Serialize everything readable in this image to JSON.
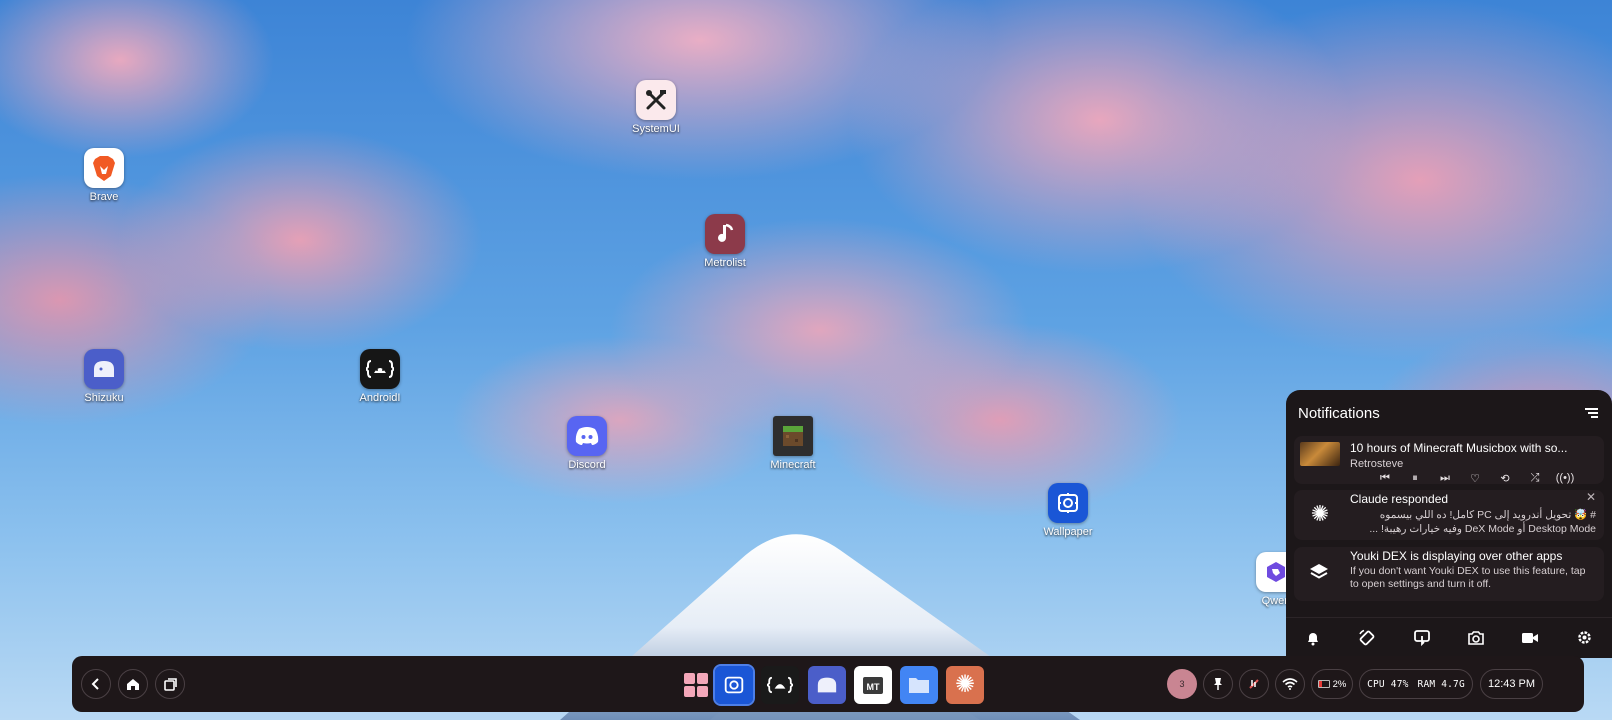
{
  "desktop": {
    "icons": [
      {
        "label": "Brave",
        "icon": "brave-lion-icon"
      },
      {
        "label": "SystemUI",
        "icon": "tools-icon"
      },
      {
        "label": "Metrolist",
        "icon": "music-note-icon"
      },
      {
        "label": "Shizuku",
        "icon": "shizuku-icon"
      },
      {
        "label": "AndroidI",
        "icon": "android-dev-icon"
      },
      {
        "label": "Discord",
        "icon": "discord-icon"
      },
      {
        "label": "Minecraft",
        "icon": "minecraft-block-icon"
      },
      {
        "label": "Wallpaper",
        "icon": "wallpaper-gear-icon"
      },
      {
        "label": "Qwen",
        "icon": "qwen-icon"
      }
    ]
  },
  "notifications": {
    "title": "Notifications",
    "items": [
      {
        "type": "media",
        "title": "10 hours of Minecraft Musicbox with so...",
        "subtitle": "Retrosteve",
        "controls": [
          "previous",
          "pause",
          "next",
          "favorite",
          "repeat",
          "shuffle",
          "cast"
        ]
      },
      {
        "type": "message",
        "title": "Claude responded",
        "line1": "# 🤯 تحويل أندرويد إلى PC كامل! ده اللي بيسموه",
        "line2": "Desktop Mode أو DeX Mode وفيه خيارات رهيبة! ..."
      },
      {
        "type": "system",
        "title": "Youki DEX is displaying over other apps",
        "body": "If you don't want Youki DEX to use this feature, tap to open settings and turn it off."
      }
    ],
    "quick_toggles": [
      "bell-icon",
      "rotate-icon",
      "screen-touch-icon",
      "camera-icon",
      "video-icon",
      "settings-icon"
    ]
  },
  "taskbar": {
    "nav": [
      "back-icon",
      "home-icon",
      "recents-icon"
    ],
    "apps": [
      "start-menu",
      "Wallpaper",
      "AndroidI",
      "Shizuku",
      "MT Manager",
      "Files",
      "Claude"
    ],
    "tray": {
      "badge_count": "3",
      "battery": "2%",
      "cpu": "CPU 47%",
      "ram": "RAM 4.7G",
      "time": "12:43 PM"
    }
  },
  "colors": {
    "panel_bg": "#1c1719",
    "taskbar_bg": "#1e1719",
    "accent_blue": "#1a56d6",
    "claude_orange": "#d9714e",
    "battery_red": "#e53935"
  }
}
